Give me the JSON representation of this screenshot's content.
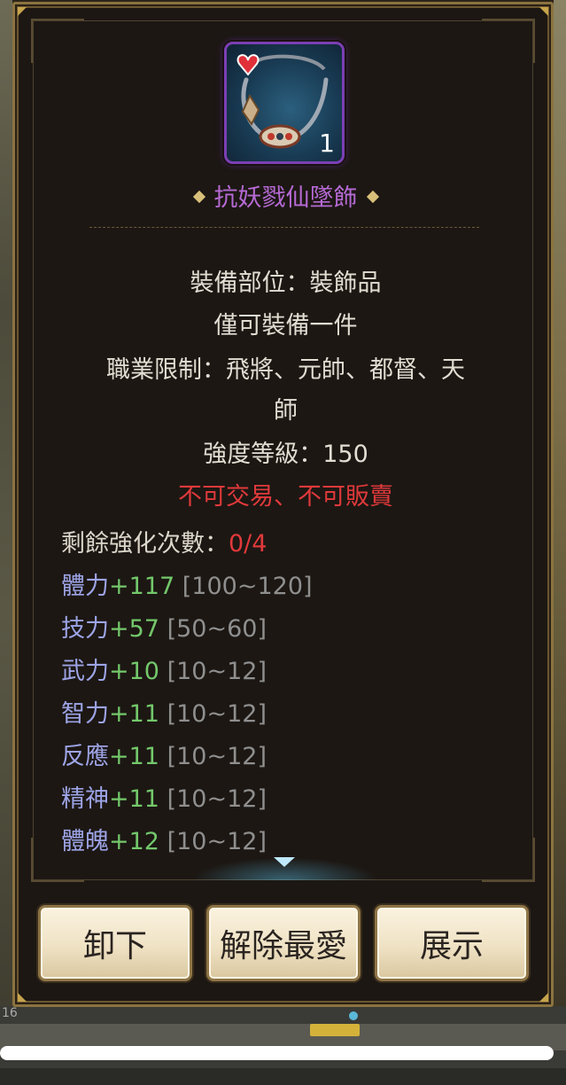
{
  "item": {
    "name": "抗妖戮仙墜飾",
    "count": "1",
    "icon": "necklace-icon"
  },
  "info": {
    "equip_slot": "裝備部位：裝飾品",
    "unique": "僅可裝備一件",
    "class_restriction_line1": "職業限制：飛將、元帥、都督、天",
    "class_restriction_line2": "師",
    "strength_level": "強度等級：150",
    "trade_restriction": "不可交易、不可販賣"
  },
  "enhance": {
    "label": "剩餘強化次數：",
    "value": "0/4"
  },
  "stats": [
    {
      "name": "體力",
      "value": "+117",
      "range": "[100~120]"
    },
    {
      "name": "技力",
      "value": "+57",
      "range": "[50~60]"
    },
    {
      "name": "武力",
      "value": "+10",
      "range": "[10~12]"
    },
    {
      "name": "智力",
      "value": "+11",
      "range": "[10~12]"
    },
    {
      "name": "反應",
      "value": "+11",
      "range": "[10~12]"
    },
    {
      "name": "精神",
      "value": "+11",
      "range": "[10~12]"
    },
    {
      "name": "體魄",
      "value": "+12",
      "range": "[10~12]"
    }
  ],
  "buttons": {
    "unequip": "卸下",
    "unfavorite": "解除最愛",
    "show": "展示"
  },
  "footer": {
    "number": "16"
  },
  "colors": {
    "item_name": "#b66ad4",
    "restriction_red": "#e0393b",
    "stat_name": "#9da4e6",
    "stat_value": "#73c86b",
    "stat_range": "#8f8f8f"
  }
}
